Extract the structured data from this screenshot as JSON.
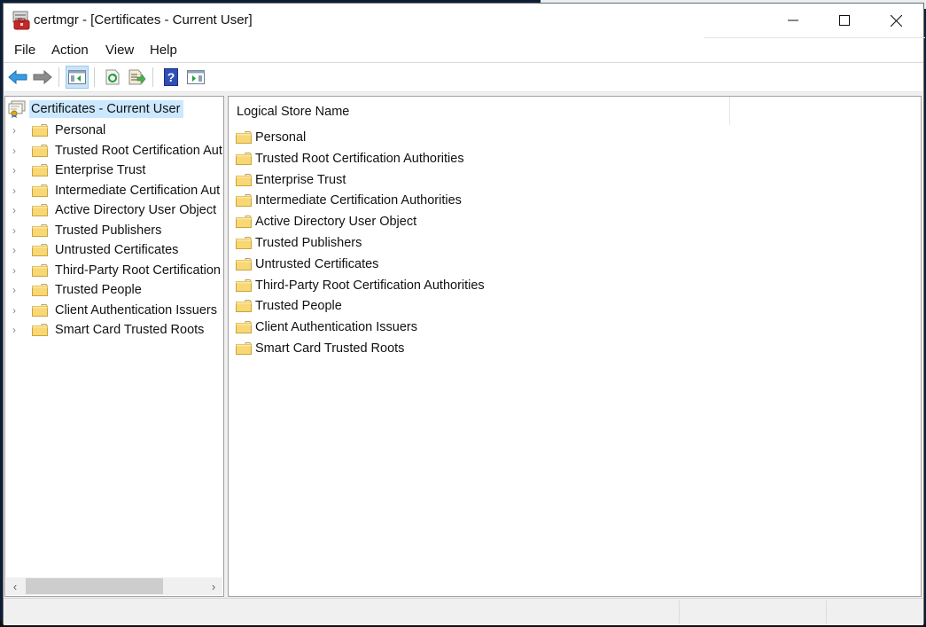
{
  "window": {
    "title": "certmgr - [Certificates - Current User]",
    "controls": {
      "minimize": "minimize",
      "maximize": "maximize",
      "close": "close"
    }
  },
  "menubar": {
    "items": [
      {
        "label": "File"
      },
      {
        "label": "Action"
      },
      {
        "label": "View"
      },
      {
        "label": "Help"
      }
    ]
  },
  "toolbar": {
    "buttons": [
      {
        "icon": "back-arrow-icon",
        "tooltip": "Back"
      },
      {
        "icon": "forward-arrow-icon",
        "tooltip": "Forward"
      },
      {
        "icon": "show-hide-console-tree-icon",
        "tooltip": "Show/Hide Console Tree",
        "active": true
      },
      {
        "icon": "refresh-icon",
        "tooltip": "Refresh"
      },
      {
        "icon": "export-list-icon",
        "tooltip": "Export List"
      },
      {
        "icon": "help-icon",
        "tooltip": "Help"
      },
      {
        "icon": "show-hide-action-pane-icon",
        "tooltip": "Show/Hide Action Pane"
      }
    ]
  },
  "tree": {
    "root": {
      "label": "Certificates - Current User",
      "icon": "certificate-store-icon",
      "selected": true
    },
    "items": [
      {
        "label": "Personal"
      },
      {
        "label": "Trusted Root Certification Aut"
      },
      {
        "label": "Enterprise Trust"
      },
      {
        "label": "Intermediate Certification Aut"
      },
      {
        "label": "Active Directory User Object"
      },
      {
        "label": "Trusted Publishers"
      },
      {
        "label": "Untrusted Certificates"
      },
      {
        "label": "Third-Party Root Certification"
      },
      {
        "label": "Trusted People"
      },
      {
        "label": "Client Authentication Issuers"
      },
      {
        "label": "Smart Card Trusted Roots"
      }
    ],
    "scrollbar": {
      "left_arrow": "‹",
      "right_arrow": "›"
    }
  },
  "list": {
    "column_header": "Logical Store Name",
    "items": [
      {
        "label": "Personal"
      },
      {
        "label": "Trusted Root Certification Authorities"
      },
      {
        "label": "Enterprise Trust"
      },
      {
        "label": "Intermediate Certification Authorities"
      },
      {
        "label": "Active Directory User Object"
      },
      {
        "label": "Trusted Publishers"
      },
      {
        "label": "Untrusted Certificates"
      },
      {
        "label": "Third-Party Root Certification Authorities"
      },
      {
        "label": "Trusted People"
      },
      {
        "label": "Client Authentication Issuers"
      },
      {
        "label": "Smart Card Trusted Roots"
      }
    ]
  },
  "colors": {
    "selection": "#cce8ff",
    "folder": "#f8d775",
    "accent_blue": "#2b88d8"
  }
}
